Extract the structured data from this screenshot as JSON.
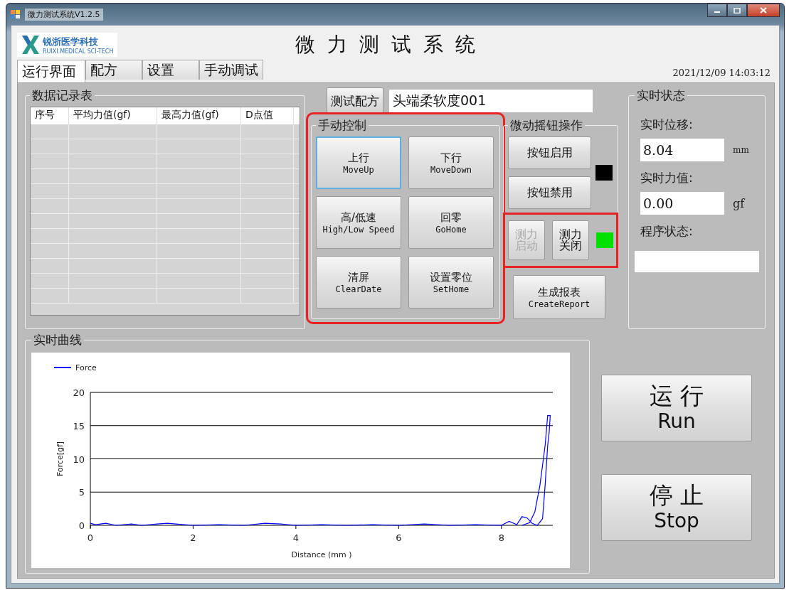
{
  "window": {
    "title": "微力测试系统V1.2.5"
  },
  "logo": {
    "name": "锐浙医学科技",
    "subtitle": "RUIXI MEDICAL SCI-TECH"
  },
  "app_title": "微 力 测 试 系 统",
  "tabs": [
    {
      "label": "运行界面",
      "selected": true
    },
    {
      "label": "配方",
      "selected": false
    },
    {
      "label": "设置",
      "selected": false
    },
    {
      "label": "手动调试",
      "selected": false
    }
  ],
  "datetime": "2021/12/09 14:03:12",
  "data_table": {
    "title": "数据记录表",
    "columns": [
      "序号",
      "平均力值(gf)",
      "最高力值(gf)",
      "D点值"
    ]
  },
  "recipe": {
    "button": "测试配方",
    "value": "头端柔软度001"
  },
  "manual_control": {
    "title": "手动控制",
    "highlighted": true,
    "buttons": [
      {
        "label": "上行",
        "sublabel": "MoveUp",
        "focused": true
      },
      {
        "label": "下行",
        "sublabel": "MoveDown",
        "focused": false
      },
      {
        "label": "高/低速",
        "sublabel": "High/Low Speed",
        "focused": false
      },
      {
        "label": "回零",
        "sublabel": "GoHome",
        "focused": false
      },
      {
        "label": "清屏",
        "sublabel": "ClearDate",
        "focused": false
      },
      {
        "label": "设置零位",
        "sublabel": "SetHome",
        "focused": false
      }
    ]
  },
  "rocker": {
    "title": "微动摇钮操作",
    "buttons": [
      "按钮启用",
      "按钮禁用"
    ],
    "indicators": [
      {
        "color": "#000000"
      },
      {
        "color": "#00e000"
      }
    ],
    "force_buttons": {
      "highlighted": true,
      "items": [
        {
          "label": "测力启动",
          "disabled": true
        },
        {
          "label": "测力关闭",
          "disabled": false
        }
      ]
    }
  },
  "report_button": {
    "label": "生成报表",
    "sublabel": "CreateReport"
  },
  "status": {
    "title": "实时状态",
    "displacement_label": "实时位移:",
    "displacement": "8.04",
    "displacement_unit": "mm",
    "force_label": "实时力值:",
    "force": "0.00",
    "force_unit": "gf",
    "program_label": "程序状态:"
  },
  "curve": {
    "title": "实时曲线",
    "chart_data": {
      "type": "line",
      "grid": true,
      "xlabel": "Distance (mm )",
      "ylabel": "Force[gf]",
      "xlim": [
        0,
        9
      ],
      "ylim": [
        0,
        20
      ],
      "xticks": [
        0,
        2,
        4,
        6,
        8
      ],
      "yticks": [
        0,
        5,
        10,
        15,
        20
      ],
      "x": [
        0,
        0.1,
        0.3,
        0.5,
        0.8,
        1,
        1.3,
        1.5,
        2,
        2.5,
        3,
        3.4,
        3.7,
        4,
        4.5,
        5,
        5.5,
        6,
        6.5,
        7,
        7.5,
        8,
        8.15,
        8.3,
        8.4,
        8.5,
        8.6,
        8.7,
        8.8,
        8.85,
        8.9,
        8.93,
        8.95,
        8.9,
        8.85,
        8.75,
        8.65,
        8.55,
        8.4
      ],
      "series": [
        {
          "name": "Force",
          "color": "#0000ff",
          "values": [
            0.3,
            0.1,
            0.3,
            0,
            0.2,
            0,
            0.2,
            0.3,
            0,
            0.1,
            0,
            0.3,
            0.2,
            0,
            0.1,
            0,
            0.1,
            0,
            0.2,
            0,
            0.1,
            0,
            0.6,
            0.1,
            1.3,
            1.1,
            0.3,
            0,
            1,
            6,
            12,
            14,
            16.5,
            16.5,
            12,
            6,
            2,
            0.4,
            0
          ]
        }
      ]
    }
  },
  "run_button": {
    "label": "运 行",
    "sublabel": "Run"
  },
  "stop_button": {
    "label": "停 止",
    "sublabel": "Stop"
  }
}
